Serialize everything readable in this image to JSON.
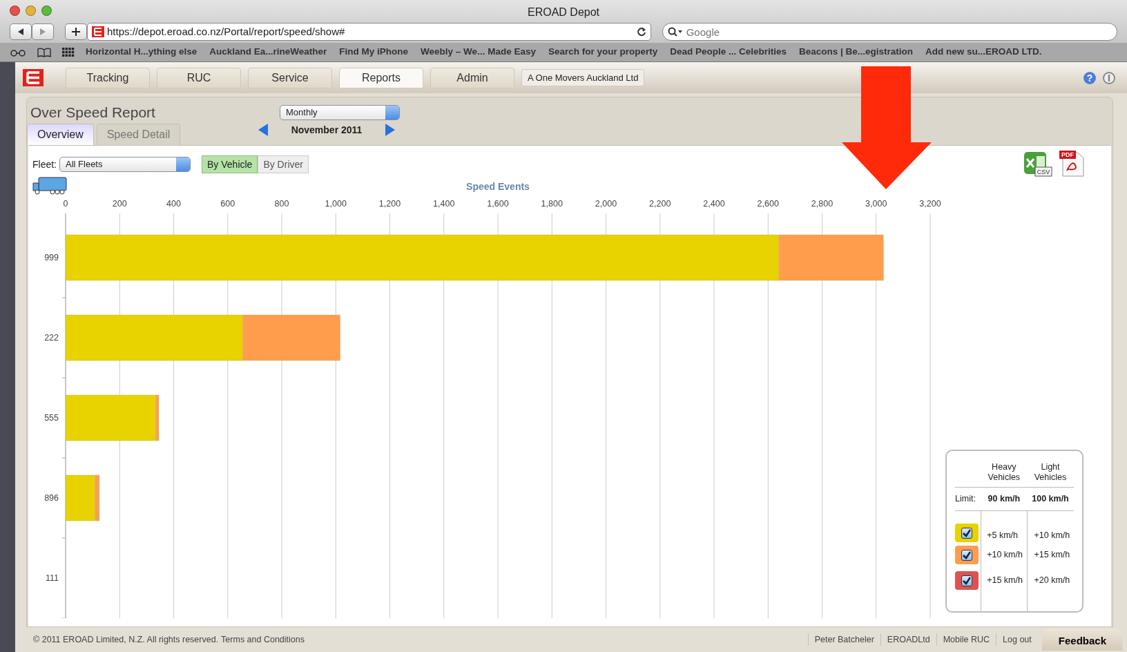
{
  "browser": {
    "title": "EROAD Depot",
    "url": "https://depot.eroad.co.nz/Portal/report/speed/show#",
    "search": {
      "placeholder": "Google"
    },
    "bookmarks": [
      "Horizontal H...ything else",
      "Auckland Ea...rineWeather",
      "Find My iPhone",
      "Weebly – We... Made Easy",
      "Search for your property",
      "Dead People ... Celebrities",
      "Beacons | Be...egistration",
      "Add new su...EROAD LTD."
    ]
  },
  "nav": {
    "tabs": [
      {
        "label": "Tracking",
        "selected": false
      },
      {
        "label": "RUC",
        "selected": false
      },
      {
        "label": "Service",
        "selected": false
      },
      {
        "label": "Reports",
        "selected": true
      },
      {
        "label": "Admin",
        "selected": false
      }
    ],
    "account": "A One Movers Auckland Ltd",
    "help_mark": "?"
  },
  "report": {
    "title": "Over Speed Report",
    "period": {
      "value": "Monthly"
    },
    "date": "November 2011",
    "tabs": [
      {
        "label": "Overview",
        "selected": true
      },
      {
        "label": "Speed Detail",
        "selected": false
      }
    ],
    "fleet": {
      "label": "Fleet:",
      "value": "All Fleets"
    },
    "group_by": [
      {
        "label": "By Vehicle",
        "selected": true
      },
      {
        "label": "By Driver",
        "selected": false
      }
    ],
    "export": {
      "csv_label": "CSV",
      "pdf_label": "PDF"
    },
    "chart_data": {
      "type": "bar",
      "orientation": "horizontal",
      "stacked": true,
      "title": "Speed Events",
      "categories": [
        "999",
        "222",
        "555",
        "896",
        "111"
      ],
      "series": [
        {
          "color": "#e8d200",
          "values": [
            2640,
            655,
            334,
            109,
            0
          ]
        },
        {
          "color": "#ff9d4d",
          "values": [
            387,
            361,
            11,
            16,
            0
          ]
        }
      ],
      "xlim": [
        0,
        3200
      ],
      "grid": true,
      "xticks": [
        {
          "value": 0,
          "label": "0"
        },
        {
          "value": 200,
          "label": "200"
        },
        {
          "value": 400,
          "label": "400"
        },
        {
          "value": 600,
          "label": "600"
        },
        {
          "value": 800,
          "label": "800"
        },
        {
          "value": 1000,
          "label": "1,000"
        },
        {
          "value": 1200,
          "label": "1,200"
        },
        {
          "value": 1400,
          "label": "1,400"
        },
        {
          "value": 1600,
          "label": "1,600"
        },
        {
          "value": 1800,
          "label": "1,800"
        },
        {
          "value": 2000,
          "label": "2,000"
        },
        {
          "value": 2200,
          "label": "2,200"
        },
        {
          "value": 2400,
          "label": "2,400"
        },
        {
          "value": 2600,
          "label": "2,600"
        },
        {
          "value": 2800,
          "label": "2,800"
        },
        {
          "value": 3000,
          "label": "3,000"
        },
        {
          "value": 3200,
          "label": "3,200"
        }
      ]
    },
    "legend": {
      "columns": [
        "Heavy Vehicles",
        "Light Vehicles"
      ],
      "limit": {
        "label": "Limit:",
        "values": [
          "90 km/h",
          "100 km/h"
        ]
      },
      "rows": [
        {
          "color": "#e8d200",
          "checked": true,
          "values": [
            "+5 km/h",
            "+10 km/h"
          ]
        },
        {
          "color": "#ff9d4d",
          "checked": true,
          "values": [
            "+10 km/h",
            "+15 km/h"
          ]
        },
        {
          "color": "#e05252",
          "checked": true,
          "values": [
            "+15 km/h",
            "+20 km/h"
          ]
        }
      ]
    }
  },
  "footer": {
    "copyright": "© 2011 EROAD Limited, N.Z. All rights reserved.",
    "terms": "Terms and Conditions",
    "links": [
      "Peter Batcheler",
      "EROADLtd",
      "Mobile RUC",
      "Log out"
    ],
    "feedback": "Feedback"
  }
}
